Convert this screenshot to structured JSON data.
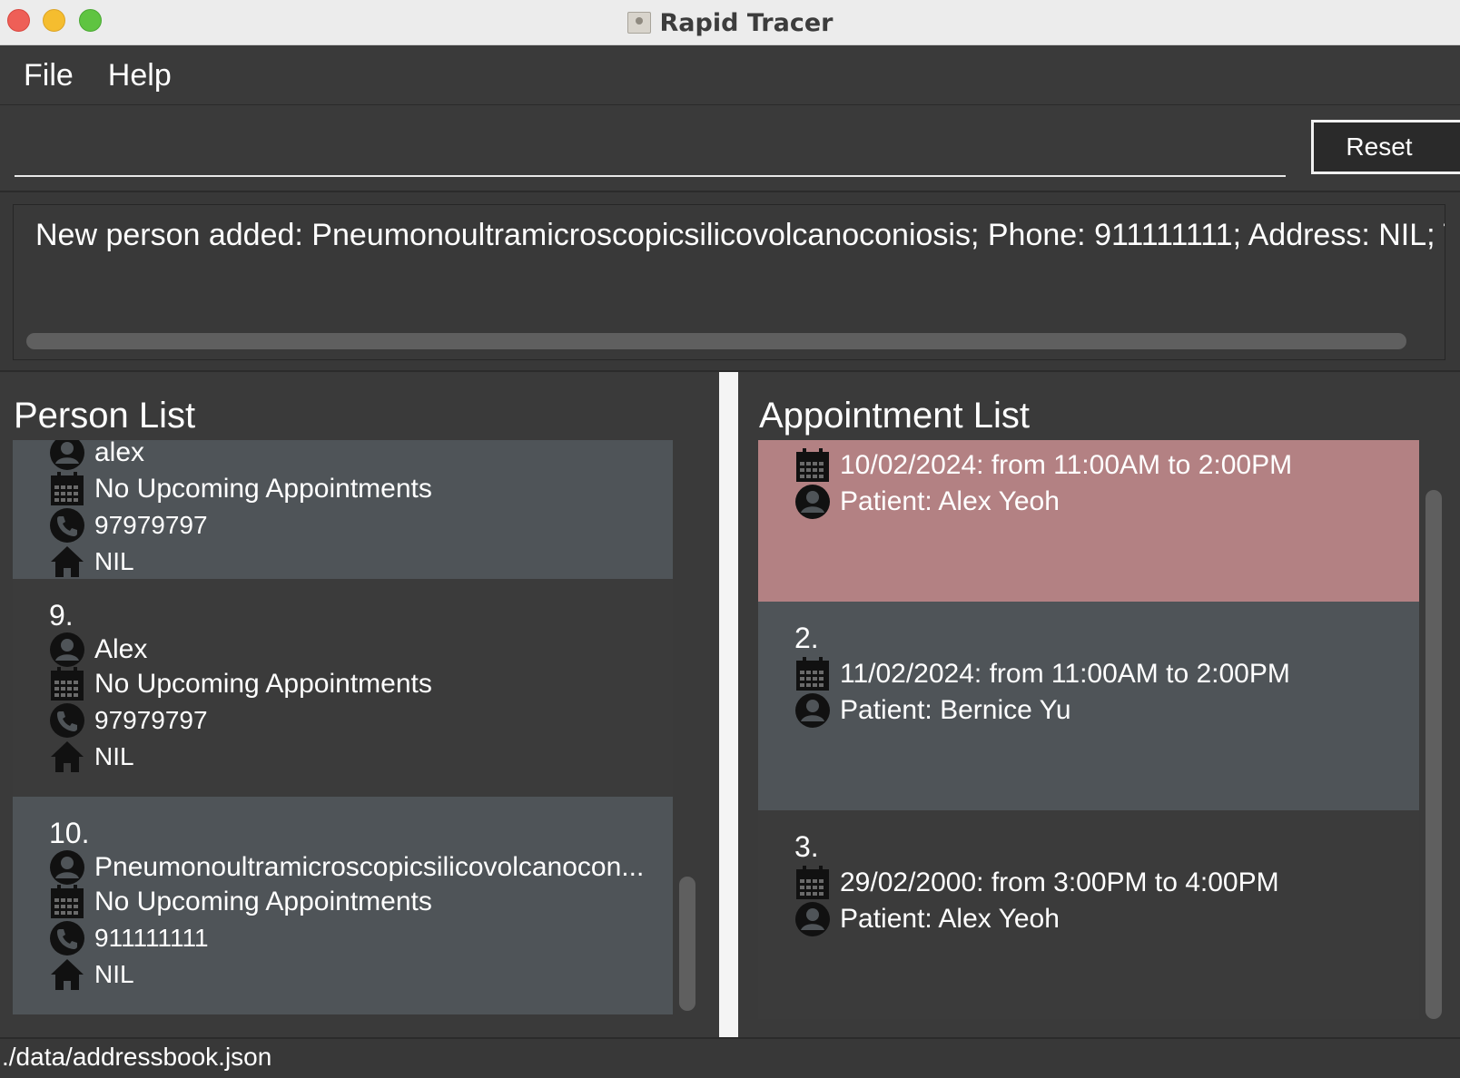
{
  "window": {
    "title": "Rapid Tracer"
  },
  "menu": {
    "file": "File",
    "help": "Help"
  },
  "command": {
    "value": "",
    "reset_label": "Reset"
  },
  "result": {
    "text": "New person added: Pneumonoultramicroscopicsilicovolcanoconiosis; Phone: 911111111; Address: NIL; Tags"
  },
  "person_list": {
    "title": "Person List",
    "items": [
      {
        "index": "",
        "name": "alex",
        "appointment": "No Upcoming Appointments",
        "phone": "97979797",
        "address": "NIL"
      },
      {
        "index": "9.",
        "name": "Alex",
        "appointment": "No Upcoming Appointments",
        "phone": "97979797",
        "address": "NIL"
      },
      {
        "index": "10.",
        "name": "Pneumonoultramicroscopicsilicovolcanocon...",
        "appointment": "No Upcoming Appointments",
        "phone": "911111111",
        "address": "NIL"
      }
    ]
  },
  "appointment_list": {
    "title": "Appointment List",
    "items": [
      {
        "index": "",
        "time": "10/02/2024: from 11:00AM to 2:00PM",
        "patient": "Patient: Alex Yeoh"
      },
      {
        "index": "2.",
        "time": "11/02/2024: from 11:00AM to 2:00PM",
        "patient": "Patient: Bernice Yu"
      },
      {
        "index": "3.",
        "time": "29/02/2000: from 3:00PM to 4:00PM",
        "patient": "Patient: Alex Yeoh"
      }
    ]
  },
  "status": {
    "file_path": "./data/addressbook.json"
  },
  "colors": {
    "background": "#3a3a3a",
    "card_light": "#4f5458",
    "card_dark": "#3b3b3b",
    "appointment_highlight": "#b38183"
  },
  "icons": {
    "name": "person-icon",
    "appointment": "calendar-icon",
    "phone": "phone-icon",
    "address": "home-icon"
  }
}
